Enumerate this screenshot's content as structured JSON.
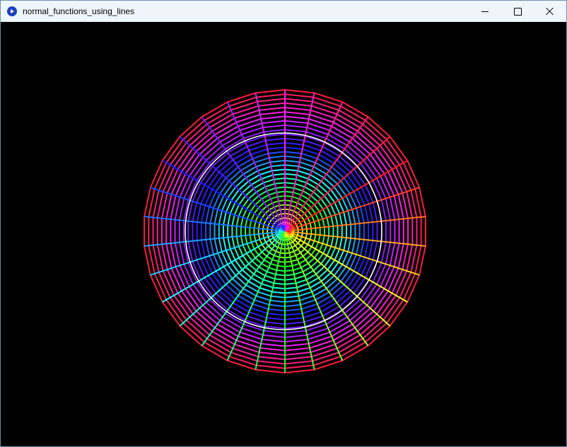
{
  "window": {
    "title": "normal_functions_using_lines"
  },
  "icons": {
    "app": "processing-app-icon",
    "minimize": "minimize-icon",
    "maximize": "maximize-icon",
    "close": "close-icon"
  },
  "sketch": {
    "background": "#000000",
    "spokes": 30,
    "rings": 32,
    "highlight_ring_color": "#ffffff"
  }
}
